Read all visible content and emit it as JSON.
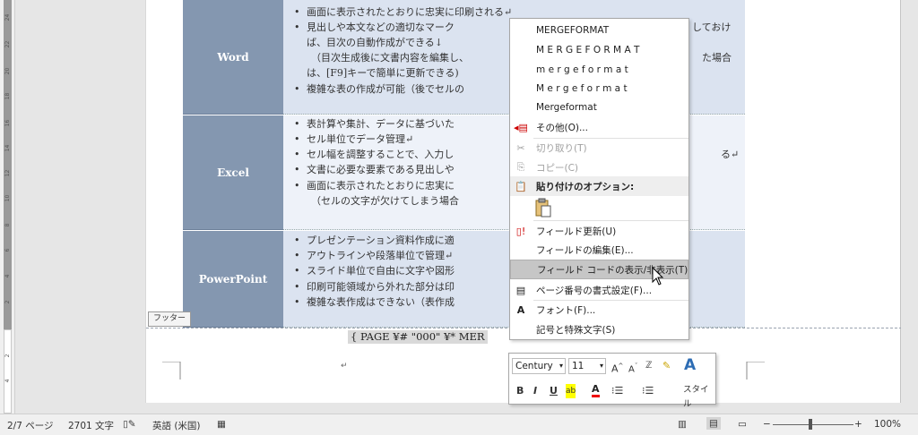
{
  "ruler": {
    "numbers": [
      "24",
      "22",
      "20",
      "18",
      "16",
      "14",
      "12",
      "10",
      "8",
      "6",
      "4",
      "2",
      "2",
      "4"
    ]
  },
  "document": {
    "rows": [
      {
        "header": "Word",
        "lines": [
          {
            "type": "bullet",
            "text": "画面に表示されたとおりに忠実に印刷される↵"
          },
          {
            "type": "bullet",
            "text": "見出しや本文などの適切なマーク"
          },
          {
            "type": "tail",
            "text": "しておけ"
          },
          {
            "type": "indent",
            "text": "ば、目次の自動作成ができる↓"
          },
          {
            "type": "indent2",
            "text": "（目次生成後に文書内容を編集し、"
          },
          {
            "type": "tail2",
            "text": "た場合"
          },
          {
            "type": "indent",
            "text": "は、[F9]キーで簡単に更新できる)"
          },
          {
            "type": "bullet",
            "text": "複雑な表の作成が可能（後でセルの"
          }
        ]
      },
      {
        "header": "Excel",
        "lines": [
          {
            "type": "bullet",
            "text": "表計算や集計、データに基づいた"
          },
          {
            "type": "bullet",
            "text": "セル単位でデータ管理↵"
          },
          {
            "type": "bullet",
            "text": "セル幅を調整することで、入力し"
          },
          {
            "type": "tail",
            "text": "る↵"
          },
          {
            "type": "bullet",
            "text": "文書に必要な要素である見出しや"
          },
          {
            "type": "bullet",
            "text": "画面に表示されたとおりに忠実に"
          },
          {
            "type": "indent",
            "text": "（セルの文字が欠けてしまう場合"
          }
        ]
      },
      {
        "header": "PowerPoint",
        "lines": [
          {
            "type": "bullet",
            "text": "プレゼンテーション資料作成に適"
          },
          {
            "type": "bullet",
            "text": "アウトラインや段落単位で管理↵"
          },
          {
            "type": "bullet",
            "text": "スライド単位で自由に文字や図形"
          },
          {
            "type": "bullet",
            "text": "印刷可能領域から外れた部分は印"
          },
          {
            "type": "bullet",
            "text": "複雑な表作成はできない（表作成"
          }
        ]
      }
    ],
    "footer_tag": "フッター",
    "field_code": "{ PAGE  ¥# \"000\"  ¥* MER",
    "return_mark": "↵"
  },
  "context_menu": {
    "items": [
      {
        "label": "MERGEFORMAT",
        "style": "normal"
      },
      {
        "label": "M E R G E F O R M A T",
        "style": "normal"
      },
      {
        "label": "m e r g e f o r m a t",
        "style": "normal"
      },
      {
        "label": "M e r g e f o r m a t",
        "style": "normal"
      },
      {
        "label": "Mergeformat",
        "style": "normal"
      },
      {
        "label": "その他(O)...",
        "icon": "more-icon",
        "style": "normal"
      },
      {
        "label": "切り取り(T)",
        "icon": "cut-icon",
        "style": "dis"
      },
      {
        "label": "コピー(C)",
        "icon": "copy-icon",
        "style": "dis"
      },
      {
        "label": "貼り付けのオプション:",
        "icon": "paste-icon",
        "style": "sect"
      },
      {
        "label": "",
        "icon": "paste-option-icon",
        "style": "normal"
      },
      {
        "label": "フィールド更新(U)",
        "icon": "update-field-icon",
        "style": "normal"
      },
      {
        "label": "フィールドの編集(E)...",
        "style": "normal"
      },
      {
        "label": "フィールド コードの表示/非表示(T)",
        "style": "hl"
      },
      {
        "label": "ページ番号の書式設定(F)...",
        "icon": "page-number-format-icon",
        "style": "normal"
      },
      {
        "label": "フォント(F)...",
        "icon": "font-icon",
        "style": "normal"
      },
      {
        "label": "記号と特殊文字(S)",
        "style": "normal"
      }
    ]
  },
  "mini_toolbar": {
    "font_name": "Century",
    "font_size": "11",
    "style_label": "スタイル",
    "grow_label": "A",
    "shrink_label": "A",
    "bold": "B",
    "italic": "I",
    "underline": "U"
  },
  "status_bar": {
    "page": "2/7 ページ",
    "words": "2701 文字",
    "language": "英語 (米国)",
    "zoom": "100%"
  },
  "colors": {
    "table_header": "#8497b0",
    "table_body": "#dbe3f0",
    "highlight": "#c6c6c6"
  }
}
